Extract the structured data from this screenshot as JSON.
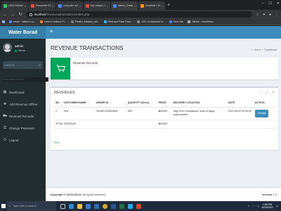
{
  "browser": {
    "tabs": [
      {
        "title": "(192) WhatsApp",
        "color": "#25d366"
      },
      {
        "title": "Document 33.pdf",
        "color": "#e04b3a"
      },
      {
        "title": "computer viruses/Stry",
        "color": "#4285f4"
      },
      {
        "title": "My Lawyer | Home",
        "color": "#e04b3a"
      },
      {
        "title": "Admin | Dashboard",
        "color": "#4285f4"
      },
      {
        "title": "localhost / 127.0.0.1",
        "color": "#f29111"
      }
    ],
    "url_host": "localhost",
    "url_path": "/revenueadmin/admin/orders.php",
    "bookmarks": [
      {
        "label": "email - failed to co...",
        "color": "#4285f4"
      },
      {
        "label": "How to redirect Pl...",
        "color": "#f48024"
      },
      {
        "label": "Predict_Malaria_cell...",
        "color": "#444"
      },
      {
        "label": "Real and Fake Face...",
        "color": "#20beff"
      },
      {
        "label": "100+ AI Machine le...",
        "color": "#333"
      },
      {
        "label": "New Tab",
        "color": "#4285f4"
      },
      {
        "label": "GitHub - mutebhas...",
        "color": "#333"
      }
    ]
  },
  "app": {
    "logo": "Water Borad",
    "user": {
      "name": "admin",
      "status": "Online"
    },
    "search_placeholder": "Search...",
    "nav_header": "MAIN NAVIGATION",
    "menu": [
      {
        "label": "Dashboard",
        "icon": "dashboard-icon",
        "glyph": "▦"
      },
      {
        "label": "Add Revenue Officer",
        "icon": "user-plus-icon",
        "glyph": "✚"
      },
      {
        "label": "Revenue Records",
        "icon": "cart-icon",
        "glyph": "⛟"
      },
      {
        "label": "Change Password",
        "icon": "key-icon",
        "glyph": "⚿"
      },
      {
        "label": "Logout",
        "icon": "logout-icon",
        "glyph": "⏻"
      }
    ],
    "page_title": "REVENUE TRANSACTIONS",
    "breadcrumb": {
      "home": "Home",
      "current": "Dashboard"
    },
    "infobox": {
      "label": "Revenue Records",
      "color": "#00a65a"
    },
    "box_title": "REVENUES",
    "table": {
      "headers": [
        "SN",
        "CUSTOMER NAME",
        "ORDER ID",
        "QUANTITY (litres)",
        "PRICE",
        "DELIVERY LOCATION",
        "DATE",
        "ACTION"
      ],
      "rows": [
        {
          "sn": "1",
          "customer": "Tins",
          "order_id": "TRANS-220824002",
          "quantity": "300",
          "price": "₦22000",
          "location": "High level roundabout, close to lagos supermarket",
          "date": "2022-08-20 00:00:00",
          "action": "Details"
        }
      ],
      "total_label": "TOTAL REVENUE",
      "total_value": "₦22000"
    },
    "print_label": "Print",
    "footer": {
      "copyright_prefix": "Copyright © 2022-08-24.",
      "copyright_suffix": "All rights reserved.",
      "version_label": "Version",
      "version": "1.0"
    }
  },
  "taskbar": {
    "search_placeholder": "Type here to search",
    "time": "1:59 PM",
    "date": "8/24/2022"
  }
}
